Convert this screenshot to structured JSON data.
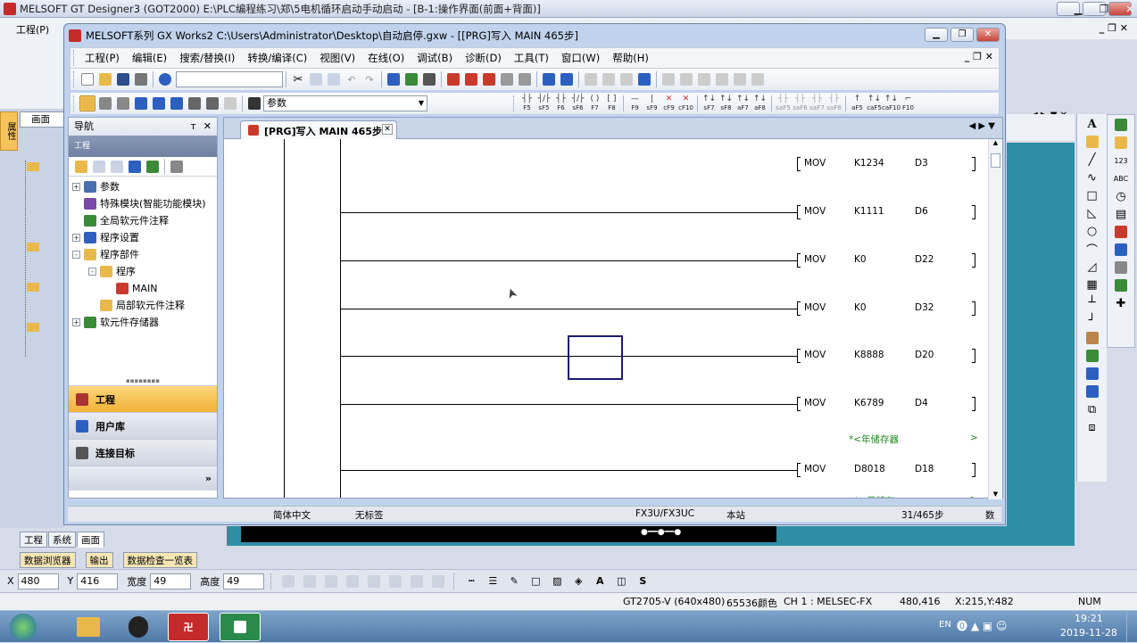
{
  "outer_window": {
    "title": "MELSOFT GT Designer3 (GOT2000) E:\\PLC编程练习\\郑\\5电机循环启动手动启动 - [B-1:操作界面(前面+背面)]",
    "menu_first": "工程(P)",
    "bottom_tabs": [
      "工程",
      "系统",
      "画面"
    ],
    "left_tab": "画面",
    "left_vertical_tab": "属性",
    "dock_tabs": [
      "数据浏览器",
      "输出",
      "数据检查一览表"
    ]
  },
  "inner_window": {
    "title": "MELSOFT系列 GX Works2 C:\\Users\\Administrator\\Desktop\\自动启停.gxw - [[PRG]写入 MAIN 465步]",
    "menu": [
      "工程(P)",
      "编辑(E)",
      "搜索/替换(I)",
      "转换/编译(C)",
      "视图(V)",
      "在线(O)",
      "调试(B)",
      "诊断(D)",
      "工具(T)",
      "窗口(W)",
      "帮助(H)"
    ],
    "search_value": "参数",
    "fkeys_1": [
      {
        "key": "F5",
        "sym": "┤├"
      },
      {
        "key": "sF5",
        "sym": "┤/├"
      },
      {
        "key": "F6",
        "sym": "┤├"
      },
      {
        "key": "sF6",
        "sym": "┤/├"
      },
      {
        "key": "F7",
        "sym": "( )"
      },
      {
        "key": "F8",
        "sym": "[ ]"
      }
    ],
    "fkeys_2": [
      {
        "key": "F9",
        "sym": "—"
      },
      {
        "key": "sF9",
        "sym": "|"
      },
      {
        "key": "cF9",
        "sym": "✕"
      },
      {
        "key": "cF10",
        "sym": "✕"
      }
    ],
    "fkeys_3": [
      {
        "key": "sF7",
        "sym": "↑↓"
      },
      {
        "key": "sF8",
        "sym": "↑↓"
      },
      {
        "key": "aF7",
        "sym": "↑↓"
      },
      {
        "key": "aF8",
        "sym": "↑↓"
      }
    ],
    "fkeys_4": [
      {
        "key": "saF5",
        "sym": "┤├"
      },
      {
        "key": "saF6",
        "sym": "┤├"
      },
      {
        "key": "saF7",
        "sym": "┤├"
      },
      {
        "key": "saF8",
        "sym": "┤├"
      }
    ],
    "fkeys_5": [
      {
        "key": "aF5",
        "sym": "↑"
      },
      {
        "key": "caF5",
        "sym": "↑↓"
      },
      {
        "key": "caF10",
        "sym": "↑↓"
      },
      {
        "key": "F10",
        "sym": "⌐"
      }
    ]
  },
  "navigation": {
    "title": "导航",
    "pin": "ᴛ",
    "close": "✕",
    "section_label": "工程",
    "tree": [
      {
        "label": "参数",
        "level": 0,
        "expander": "+"
      },
      {
        "label": "特殊模块(智能功能模块)",
        "level": 0,
        "expander": ""
      },
      {
        "label": "全局软元件注释",
        "level": 0,
        "expander": ""
      },
      {
        "label": "程序设置",
        "level": 0,
        "expander": "+"
      },
      {
        "label": "程序部件",
        "level": 0,
        "expander": "-"
      },
      {
        "label": "程序",
        "level": 1,
        "expander": "-"
      },
      {
        "label": "MAIN",
        "level": 2,
        "expander": ""
      },
      {
        "label": "局部软元件注释",
        "level": 1,
        "expander": ""
      },
      {
        "label": "软元件存储器",
        "level": 0,
        "expander": "+"
      }
    ],
    "sections": [
      "工程",
      "用户库",
      "连接目标"
    ],
    "more": "»"
  },
  "editor": {
    "tab_label": "[PRG]写入 MAIN 465步",
    "rungs": [
      {
        "op": "MOV",
        "src": "K1234",
        "dst": "D3"
      },
      {
        "op": "MOV",
        "src": "K1111",
        "dst": "D6"
      },
      {
        "op": "MOV",
        "src": "K0",
        "dst": "D22"
      },
      {
        "op": "MOV",
        "src": "K0",
        "dst": "D32"
      },
      {
        "op": "MOV",
        "src": "K8888",
        "dst": "D20"
      },
      {
        "op": "MOV",
        "src": "K6789",
        "dst": "D4"
      },
      {
        "op": "MOV",
        "src": "D8018",
        "dst": "D18"
      }
    ],
    "comments": [
      "*<年储存器",
      "*<月储存"
    ],
    "comment_arrow": ">"
  },
  "inner_status": {
    "language": "简体中文",
    "label": "无标签",
    "plc": "FX3U/FX3UC",
    "station": "本站",
    "steps": "31/465步",
    "extra": "数"
  },
  "coords_bar": {
    "x_label": "X",
    "x_value": "480",
    "y_label": "Y",
    "y_value": "416",
    "w_label": "宽度",
    "w_value": "49",
    "h_label": "高度",
    "h_value": "49"
  },
  "main_status": {
    "model": "GT2705-V (640x480)",
    "colors": "65536颜色",
    "channel": "CH 1 : MELSEC-FX",
    "pos": "480,416",
    "xy": "X:215,Y:482",
    "num": "NUM"
  },
  "taskbar": {
    "time": "19:21",
    "date": "2019-11-28",
    "lang": "EN"
  },
  "colors": {
    "title_grad_top": "#e9eef7",
    "accent_orange": "#f6c35a",
    "selection_box": "#1a1a6e",
    "comment_green": "#1f8a1f"
  }
}
